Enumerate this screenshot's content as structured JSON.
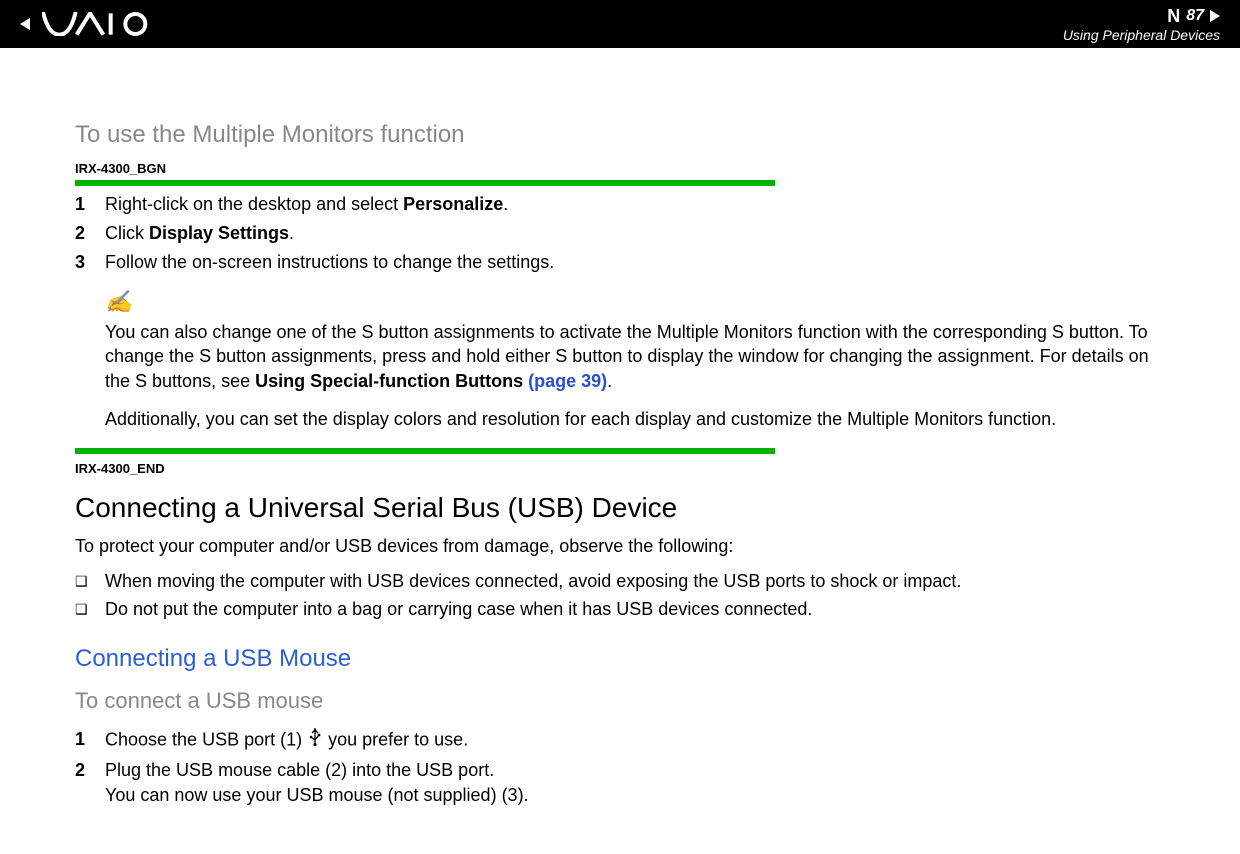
{
  "header": {
    "logo": "VAIO",
    "page_number": "87",
    "n_letter": "N",
    "section_title": "Using Peripheral Devices"
  },
  "sections": {
    "multi_monitor": {
      "heading": "To use the Multiple Monitors function",
      "tag_begin": "IRX-4300_BGN",
      "tag_end": "IRX-4300_END",
      "steps": [
        {
          "num": "1",
          "pre": "Right-click on the desktop and select ",
          "bold": "Personalize",
          "post": "."
        },
        {
          "num": "2",
          "pre": "Click ",
          "bold": "Display Settings",
          "post": "."
        },
        {
          "num": "3",
          "pre": "Follow the on-screen instructions to change the settings.",
          "bold": "",
          "post": ""
        }
      ],
      "note_icon": "✍",
      "note_text_a": "You can also change one of the S button assignments to activate the Multiple Monitors function with the corresponding S button. To change the S button assignments, press and hold either S button to display the window for changing the assignment. For details on the S buttons, see ",
      "note_bold": "Using Special-function Buttons ",
      "note_link": "(page 39)",
      "note_text_b": ".",
      "note_para2": "Additionally, you can set the display colors and resolution for each display and customize the Multiple Monitors function."
    },
    "usb_device": {
      "heading": "Connecting a Universal Serial Bus (USB) Device",
      "intro": "To protect your computer and/or USB devices from damage, observe the following:",
      "bullets": [
        "When moving the computer with USB devices connected, avoid exposing the USB ports to shock or impact.",
        "Do not put the computer into a bag or carrying case when it has USB devices connected."
      ]
    },
    "usb_mouse": {
      "heading_blue": "Connecting a USB Mouse",
      "sub_gray": "To connect a USB mouse",
      "steps": [
        {
          "num": "1",
          "pre": "Choose the USB port (1) ",
          "symbol": true,
          "post": " you prefer to use."
        },
        {
          "num": "2",
          "pre": "Plug the USB mouse cable (2) into the USB port.",
          "post": "",
          "line2": "You can now use your USB mouse (not supplied) (3)."
        }
      ]
    }
  }
}
